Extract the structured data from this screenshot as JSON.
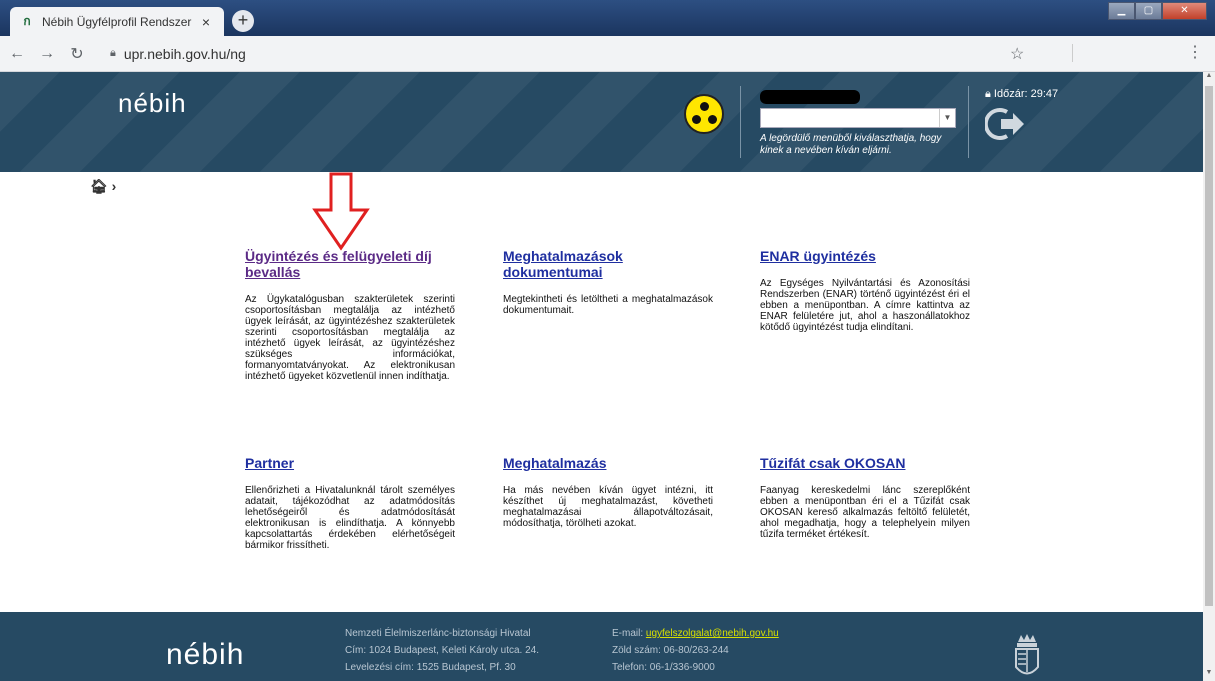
{
  "browser": {
    "tab_title": "Nébih Ügyfélprofil Rendszer",
    "tab_close": "×",
    "new_tab": "+",
    "url": "upr.nebih.gov.hu/ng"
  },
  "header": {
    "logo": "nébih",
    "select_hint": "A legördülő menüből kiválaszthatja, hogy kinek a nevében kíván eljárni.",
    "timer": "Időzár: 29:47"
  },
  "cards": [
    {
      "title": "Ügyintézés és felügyeleti díj bevallás",
      "text": "Az Ügykatalógusban szakterületek szerinti csoportosításban megtalálja az intézhető ügyek leírását, az ügyintézéshez szakterületek szerinti csoportosításban megtalálja az intézhető ügyek leírását, az ügyintézéshez szükséges információkat, formanyomtatványokat. Az elektronikusan intézhető ügyeket közvetlenül innen indíthatja."
    },
    {
      "title": "Meghatalmazások dokumentumai",
      "text": "Megtekintheti és letöltheti a meghatalmazások dokumentumait."
    },
    {
      "title": "ENAR ügyintézés",
      "text": "Az Egységes Nyilvántartási és Azonosítási Rendszerben (ENAR) történő ügyintézést éri el ebben a menüpontban. A címre kattintva az ENAR felületére jut, ahol a haszonállatokhoz kötődő ügyintézést tudja elindítani."
    },
    {
      "title": "Partner",
      "text": "Ellenőrizheti a Hivatalunknál tárolt személyes adatait, tájékozódhat az adatmódosítás lehetőségeiről és adatmódosítását elektronikusan is elindíthatja. A könnyebb kapcsolattartás érdekében elérhetőségeit bármikor frissítheti."
    },
    {
      "title": "Meghatalmazás",
      "text": "Ha más nevében kíván ügyet intézni, itt készíthet új meghatalmazást, követheti meghatalmazásai állapotváltozásait, módosíthatja, törölheti azokat."
    },
    {
      "title": "Tűzifát csak OKOSAN",
      "text": "Faanyag kereskedelmi lánc szereplőként ebben a menüpontban éri el a Tűzifát csak OKOSAN kereső alkalmazás feltöltő felületét, ahol megadhatja, hogy a telephelyein milyen tűzifa terméket értékesít."
    }
  ],
  "footer": {
    "logo": "nébih",
    "org": "Nemzeti Élelmiszerlánc-biztonsági Hivatal",
    "address": "Cím: 1024 Budapest, Keleti Károly utca. 24.",
    "postal": "Levelezési cím: 1525 Budapest, Pf. 30",
    "email_label": "E-mail: ",
    "email": "ugyfelszolgalat@nebih.gov.hu",
    "green": "Zöld szám: 06-80/263-244",
    "phone": "Telefon: 06-1/336-9000"
  },
  "colors": {
    "header_bg": "#264a63",
    "accent_lime": "#c8d400",
    "link_blue": "#1f2fa0",
    "link_visited": "#5b2a86",
    "annotation_red": "#e02020"
  }
}
